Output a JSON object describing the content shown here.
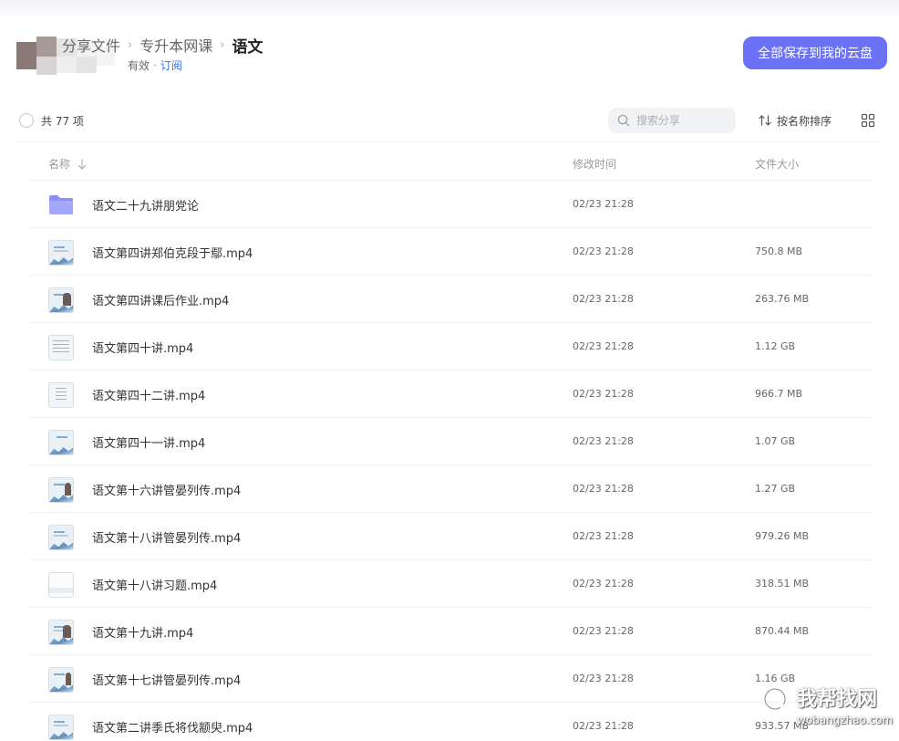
{
  "breadcrumb": {
    "root": "分享文件",
    "parent": "专升本网课",
    "current": "语文"
  },
  "meta": {
    "validity": "有效",
    "subscribe": "订阅"
  },
  "actions": {
    "save_all_label": "全部保存到我的云盘"
  },
  "toolbar": {
    "count_label": "共 77 项",
    "search_placeholder": "搜索分享",
    "sort_label": "按名称排序"
  },
  "table": {
    "columns": {
      "name": "名称",
      "modified": "修改时间",
      "size": "文件大小"
    },
    "rows": [
      {
        "type": "folder",
        "name": "语文二十九讲朋党论",
        "modified": "02/23 21:28",
        "size": ""
      },
      {
        "type": "video",
        "name": "语文第四讲郑伯克段于鄢.mp4",
        "modified": "02/23 21:28",
        "size": "750.8 MB"
      },
      {
        "type": "video",
        "name": "语文第四讲课后作业.mp4",
        "modified": "02/23 21:28",
        "size": "263.76 MB"
      },
      {
        "type": "video",
        "name": "语文第四十讲.mp4",
        "modified": "02/23 21:28",
        "size": "1.12 GB"
      },
      {
        "type": "video",
        "name": "语文第四十二讲.mp4",
        "modified": "02/23 21:28",
        "size": "966.7 MB"
      },
      {
        "type": "video",
        "name": "语文第四十一讲.mp4",
        "modified": "02/23 21:28",
        "size": "1.07 GB"
      },
      {
        "type": "video",
        "name": "语文第十六讲管晏列传.mp4",
        "modified": "02/23 21:28",
        "size": "1.27 GB"
      },
      {
        "type": "video",
        "name": "语文第十八讲管晏列传.mp4",
        "modified": "02/23 21:28",
        "size": "979.26 MB"
      },
      {
        "type": "video",
        "name": "语文第十八讲习题.mp4",
        "modified": "02/23 21:28",
        "size": "318.51 MB"
      },
      {
        "type": "video",
        "name": "语文第十九讲.mp4",
        "modified": "02/23 21:28",
        "size": "870.44 MB"
      },
      {
        "type": "video",
        "name": "语文第十七讲管晏列传.mp4",
        "modified": "02/23 21:28",
        "size": "1.16 GB"
      },
      {
        "type": "video",
        "name": "语文第二讲季氏将伐颛臾.mp4",
        "modified": "02/23 21:28",
        "size": "933.57 MB"
      }
    ]
  },
  "watermark": {
    "brand": "我帮找网",
    "url": "wobangzhao.com"
  },
  "colors": {
    "accent": "#6b72f6",
    "link": "#3a6fd8",
    "folder": "#8b8ff7"
  }
}
